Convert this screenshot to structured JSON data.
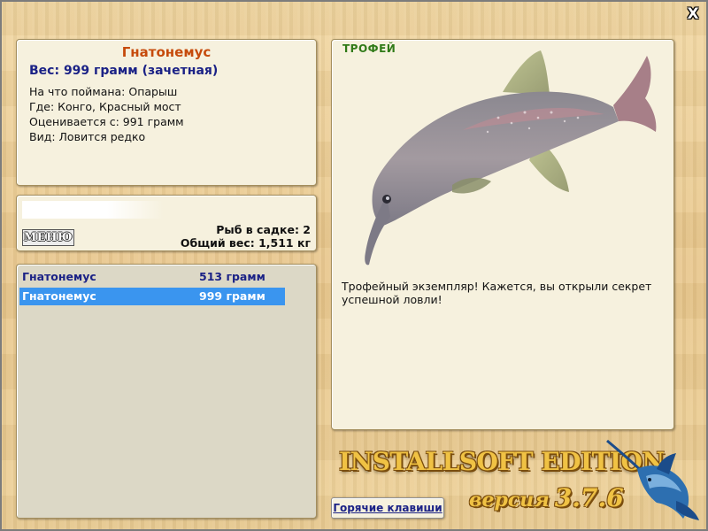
{
  "window": {
    "close_label": "X"
  },
  "info": {
    "title": "Гнатонемус",
    "weight": "Вес: 999 грамм (зачетная)",
    "details": [
      "На что поймана: Опарыш",
      "Где: Конго, Красный мост",
      "Оценивается с: 991 грамм",
      "Вид: Ловится редко"
    ]
  },
  "menu": {
    "button_label": "МЕНЮ",
    "fish_count": "Рыб в садке: 2",
    "total_weight": "Общий вес: 1,511 кг"
  },
  "catch_list": {
    "rows": [
      {
        "name": "Гнатонемус",
        "weight": "513 грамм",
        "selected": false
      },
      {
        "name": "Гнатонемус",
        "weight": "999 грамм",
        "selected": true
      }
    ],
    "selected_color": "#3a95ef"
  },
  "fish": {
    "badge": "ТРОФЕЙ",
    "image_icon": "elephantnose-fish-icon",
    "description": "Трофейный экземпляр! Кажется, вы открыли секрет успешной ловли!"
  },
  "footer": {
    "hotkeys_label": "Горячие клавиши",
    "edition": "INSTALLSOFT EDITION",
    "version_word": "версия",
    "version_number": "3.7.6",
    "logo_icon": "marlin-icon"
  }
}
